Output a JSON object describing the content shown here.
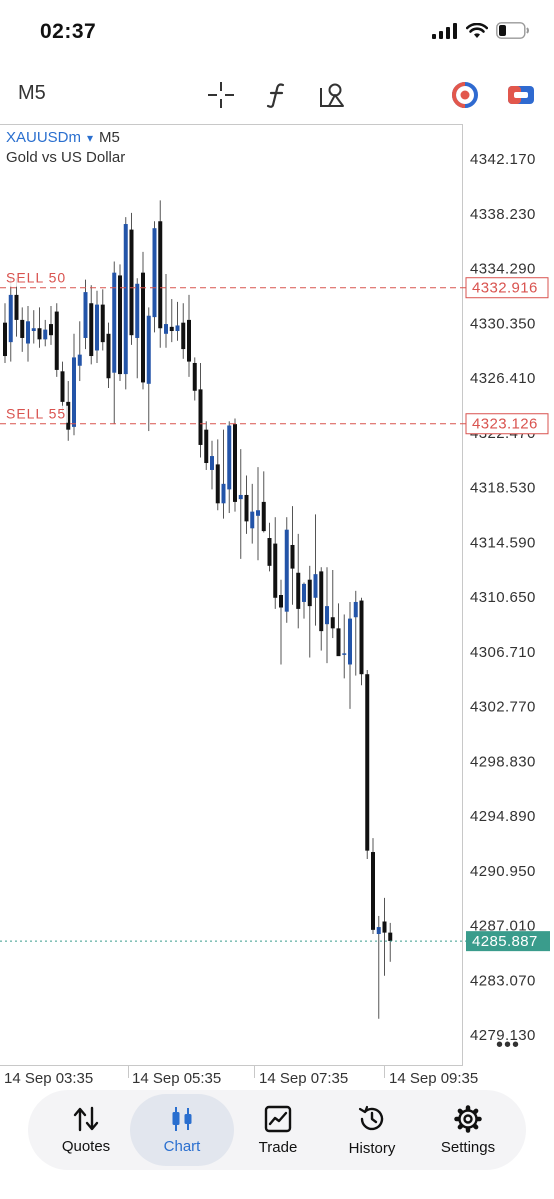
{
  "status_bar": {
    "time": "02:37"
  },
  "toolbar": {
    "timeframe": "M5",
    "icons": [
      "crosshair-icon",
      "indicator-f-icon",
      "objects-icon",
      "one-click-trading-icon",
      "trade-toggle-icon"
    ]
  },
  "chart": {
    "symbol": "XAUUSDm",
    "symbol_timeframe": "M5",
    "symbol_arrow": "▾",
    "description": "Gold vs US Dollar",
    "more": "•••",
    "price_levels": [
      "4342.170",
      "4338.230",
      "4334.290",
      "4330.350",
      "4326.410",
      "4322.470",
      "4318.530",
      "4314.590",
      "4310.650",
      "4306.710",
      "4302.770",
      "4298.830",
      "4294.890",
      "4290.950",
      "4287.010",
      "4283.070",
      "4279.130"
    ],
    "time_labels": [
      "14 Sep 03:35",
      "14 Sep 05:35",
      "14 Sep 07:35",
      "14 Sep 09:35"
    ],
    "orders": [
      {
        "label": "SELL 50",
        "price": 4332.916,
        "price_text": "4332.916",
        "color": "#d9534f"
      },
      {
        "label": "SELL 55",
        "price": 4323.126,
        "price_text": "4323.126",
        "color": "#d9534f"
      }
    ],
    "current_price": {
      "price": 4285.887,
      "price_text": "4285.887",
      "color": "#3a9c8c"
    },
    "colors": {
      "bull": "#2354a8",
      "bear": "#111111",
      "wick": "#555555"
    }
  },
  "chart_data": {
    "type": "candlestick",
    "ylim": [
      4276.9,
      4344.7
    ],
    "candles": [
      [
        4330.4,
        4331.8,
        4327.5,
        4328.0
      ],
      [
        4329.0,
        4333.6,
        4327.6,
        4332.4
      ],
      [
        4332.4,
        4333.6,
        4329.4,
        4330.6
      ],
      [
        4330.6,
        4331.5,
        4328.3,
        4329.3
      ],
      [
        4328.9,
        4331.6,
        4327.6,
        4330.5
      ],
      [
        4329.8,
        4331.3,
        4328.9,
        4330.0
      ],
      [
        4330.0,
        4331.5,
        4328.6,
        4329.2
      ],
      [
        4329.2,
        4330.6,
        4328.7,
        4329.9
      ],
      [
        4330.3,
        4331.6,
        4328.8,
        4329.5
      ],
      [
        4331.2,
        4331.8,
        4326.5,
        4327.0
      ],
      [
        4326.9,
        4327.6,
        4324.0,
        4324.7
      ],
      [
        4324.7,
        4326.2,
        4321.9,
        4322.7
      ],
      [
        4322.9,
        4329.6,
        4322.3,
        4327.9
      ],
      [
        4327.3,
        4330.5,
        4326.2,
        4328.1
      ],
      [
        4329.3,
        4333.5,
        4328.5,
        4332.6
      ],
      [
        4331.8,
        4333.1,
        4327.4,
        4328.0
      ],
      [
        4328.4,
        4332.7,
        4327.5,
        4331.7
      ],
      [
        4331.7,
        4332.8,
        4328.4,
        4329.0
      ],
      [
        4329.6,
        4330.4,
        4325.7,
        4326.4
      ],
      [
        4326.8,
        4334.8,
        4323.1,
        4334.0
      ],
      [
        4333.8,
        4334.6,
        4326.2,
        4326.7
      ],
      [
        4326.7,
        4338.0,
        4325.6,
        4337.5
      ],
      [
        4337.1,
        4338.3,
        4328.8,
        4329.5
      ],
      [
        4329.3,
        4333.6,
        4326.4,
        4333.2
      ],
      [
        4334.0,
        4335.5,
        4325.6,
        4326.1
      ],
      [
        4326.0,
        4331.5,
        4322.6,
        4330.9
      ],
      [
        4330.8,
        4337.7,
        4329.7,
        4337.2
      ],
      [
        4337.7,
        4339.2,
        4328.6,
        4330.0
      ],
      [
        4329.6,
        4333.9,
        4328.6,
        4330.3
      ],
      [
        4330.1,
        4332.1,
        4329.0,
        4329.8
      ],
      [
        4329.8,
        4331.9,
        4329.1,
        4330.2
      ],
      [
        4330.4,
        4331.8,
        4327.8,
        4328.5
      ],
      [
        4330.6,
        4332.4,
        4326.5,
        4327.6
      ],
      [
        4327.5,
        4327.9,
        4324.8,
        4325.5
      ],
      [
        4325.6,
        4327.5,
        4320.7,
        4321.6
      ],
      [
        4322.7,
        4323.3,
        4319.8,
        4320.3
      ],
      [
        4319.8,
        4321.9,
        4318.4,
        4320.8
      ],
      [
        4320.2,
        4322.0,
        4316.9,
        4317.4
      ],
      [
        4317.4,
        4322.7,
        4316.3,
        4318.8
      ],
      [
        4318.4,
        4323.3,
        4316.7,
        4323.0
      ],
      [
        4323.1,
        4323.5,
        4316.8,
        4317.5
      ],
      [
        4317.7,
        4321.3,
        4313.4,
        4318.0
      ],
      [
        4318.0,
        4319.4,
        4315.2,
        4316.1
      ],
      [
        4315.6,
        4318.8,
        4314.5,
        4316.8
      ],
      [
        4316.5,
        4320.0,
        4313.3,
        4316.9
      ],
      [
        4317.5,
        4319.7,
        4315.3,
        4315.4
      ],
      [
        4314.9,
        4316.0,
        4312.5,
        4312.9
      ],
      [
        4314.5,
        4316.4,
        4309.8,
        4310.6
      ],
      [
        4310.8,
        4311.9,
        4305.8,
        4309.9
      ],
      [
        4309.6,
        4316.4,
        4308.8,
        4315.5
      ],
      [
        4314.4,
        4317.2,
        4310.1,
        4312.7
      ],
      [
        4312.4,
        4315.2,
        4308.4,
        4309.8
      ],
      [
        4310.3,
        4311.7,
        4309.1,
        4311.6
      ],
      [
        4311.9,
        4312.9,
        4306.3,
        4310.0
      ],
      [
        4310.6,
        4316.6,
        4308.6,
        4312.3
      ],
      [
        4312.5,
        4312.8,
        4306.8,
        4308.2
      ],
      [
        4308.7,
        4312.8,
        4305.9,
        4310.0
      ],
      [
        4309.2,
        4312.6,
        4307.7,
        4308.4
      ],
      [
        4308.4,
        4310.2,
        4306.5,
        4306.4
      ],
      [
        4306.6,
        4309.4,
        4304.8,
        4306.6
      ],
      [
        4305.8,
        4310.3,
        4302.6,
        4309.1
      ],
      [
        4309.2,
        4311.1,
        4305.0,
        4310.3
      ],
      [
        4310.4,
        4310.6,
        4304.3,
        4305.1
      ],
      [
        4305.1,
        4305.4,
        4291.8,
        4292.4
      ],
      [
        4292.3,
        4293.3,
        4286.4,
        4286.7
      ],
      [
        4286.4,
        4287.7,
        4280.3,
        4286.9
      ],
      [
        4287.3,
        4289.0,
        4283.4,
        4286.5
      ],
      [
        4286.5,
        4287.2,
        4284.4,
        4285.9
      ]
    ]
  },
  "tabbar": {
    "tabs": [
      {
        "label": "Quotes",
        "icon": "quotes-arrows-icon"
      },
      {
        "label": "Chart",
        "icon": "chart-candles-icon"
      },
      {
        "label": "Trade",
        "icon": "trade-chart-icon"
      },
      {
        "label": "History",
        "icon": "history-clock-icon"
      },
      {
        "label": "Settings",
        "icon": "settings-gear-icon"
      }
    ]
  }
}
